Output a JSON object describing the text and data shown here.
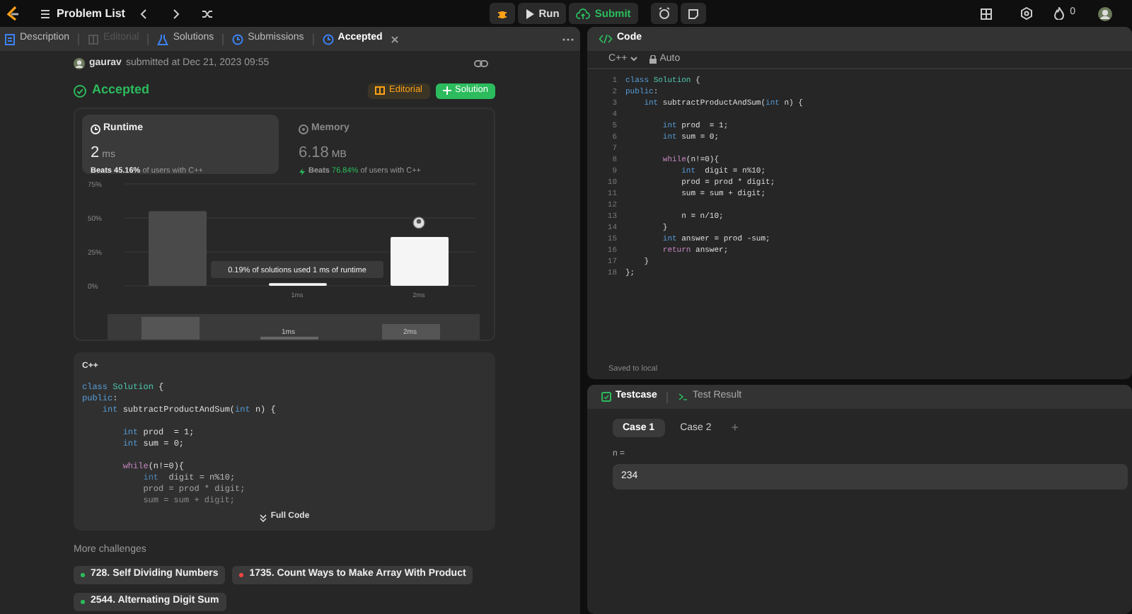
{
  "top_bar": {
    "problem_list": "Problem List",
    "run": "Run",
    "submit": "Submit",
    "streak_count": "0"
  },
  "left_tabs": [
    {
      "label": "Description",
      "selected": false,
      "disabled": false,
      "closable": false
    },
    {
      "label": "Editorial",
      "selected": false,
      "disabled": true,
      "closable": false
    },
    {
      "label": "Solutions",
      "selected": false,
      "disabled": false,
      "closable": false
    },
    {
      "label": "Submissions",
      "selected": false,
      "disabled": false,
      "closable": false
    },
    {
      "label": "Accepted",
      "selected": true,
      "disabled": false,
      "closable": true
    }
  ],
  "submission": {
    "user": "gaurav",
    "submitted_text": "submitted at Dec 21, 2023 09:55",
    "status": "Accepted",
    "editorial_button": "Editorial",
    "solution_button": "Solution"
  },
  "stats": [
    {
      "label": "Runtime",
      "value": "2",
      "unit": "ms",
      "beats_label": "Beats",
      "beats_percent": "45.16%",
      "beats_suffix": "of users with C++",
      "selected": true
    },
    {
      "label": "Memory",
      "value": "6.18",
      "unit": "MB",
      "beats_label": "Beats",
      "beats_percent": "76.84%",
      "beats_suffix": "of users with C++",
      "selected": false
    }
  ],
  "runtime_chart": {
    "chart_data": {
      "type": "bar",
      "categories": [
        null,
        "1ms",
        "2ms"
      ],
      "values": [
        55,
        2,
        36
      ],
      "ylim": [
        0,
        75
      ],
      "yticks": [
        {
          "value": 0,
          "label": "0%"
        },
        {
          "value": 25,
          "label": "25%"
        },
        {
          "value": 50,
          "label": "50%"
        },
        {
          "value": 75,
          "label": "75%"
        }
      ],
      "annotations": [
        {
          "text": "0.19% of solutions used 1 ms of runtime"
        }
      ]
    },
    "range_selector": {
      "labels": [
        "1ms",
        "2ms"
      ]
    }
  },
  "code_preview": {
    "language": "C++",
    "code": "class Solution {\npublic:\n    int subtractProductAndSum(int n) {\n\n        int prod  = 1;\n        int sum = 0;\n\n        while(n!=0){\n            int  digit = n%10;\n            prod = prod * digit;\n            sum = sum + digit;",
    "expand_button": "Full Code"
  },
  "more_challenges": {
    "title": "More challenges",
    "items": [
      {
        "label": "728. Self Dividing Numbers",
        "color": "#2cbb5d"
      },
      {
        "label": "1735. Count Ways to Make Array With Product",
        "color": "#ef4743"
      },
      {
        "label": "2544. Alternating Digit Sum",
        "color": "#2cbb5d"
      }
    ]
  },
  "editor": {
    "tab": "Code",
    "language": "C++",
    "mode": "Auto",
    "line_numbers": [
      "1",
      "2",
      "3",
      "4",
      "5",
      "6",
      "7",
      "8",
      "9",
      "10",
      "11",
      "12",
      "13",
      "14",
      "15",
      "16",
      "17",
      "18"
    ],
    "code": "class Solution {\npublic:\n    int subtractProductAndSum(int n) {\n\n        int prod  = 1;\n        int sum = 0;\n\n        while(n!=0){\n            int  digit = n%10;\n            prod = prod * digit;\n            sum = sum + digit;\n\n            n = n/10;\n        }\n        int answer = prod -sum;\n        return answer;\n    }\n};",
    "status": "Saved to local"
  },
  "testcase": {
    "tabs": [
      {
        "label": "Testcase",
        "selected": true
      },
      {
        "label": "Test Result",
        "selected": false
      }
    ],
    "cases": [
      {
        "label": "Case 1",
        "selected": true
      },
      {
        "label": "Case 2",
        "selected": false
      }
    ],
    "add_button": "+",
    "variable_label": "n =",
    "value": "234"
  }
}
